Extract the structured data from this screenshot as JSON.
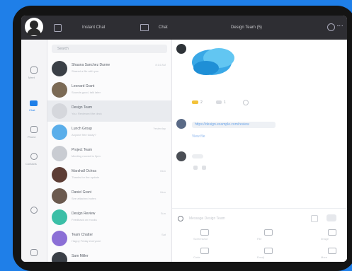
{
  "topbar": {
    "left_tab": "Instant Chat",
    "center_tab": "Chat",
    "title": "Design Team (5)"
  },
  "search": {
    "placeholder": "Search"
  },
  "contacts": [
    {
      "name": "Shauna Sanchez Dunne",
      "preview": "Shared a file with you",
      "time": "8:14 AM",
      "avatar_color": "#3a3f46"
    },
    {
      "name": "Leonard Grant",
      "preview": "Sounds good, talk later",
      "time": "",
      "avatar_color": "#7b6a55"
    },
    {
      "name": "Design Team",
      "preview": "You: Reviewed the deck",
      "time": "",
      "avatar_color": "#d5d7dc",
      "active": true
    },
    {
      "name": "Lunch Group",
      "preview": "Anyone free today?",
      "time": "Yesterday",
      "avatar_color": "#5aaeea"
    },
    {
      "name": "Project Team",
      "preview": "Meeting moved to 3pm",
      "time": "",
      "avatar_color": "#c9ccd2"
    },
    {
      "name": "Marshall Ochoa",
      "preview": "Thanks for the update",
      "time": "Mon",
      "avatar_color": "#5d3d35"
    },
    {
      "name": "Daniel Grant",
      "preview": "See attached notes",
      "time": "Mon",
      "avatar_color": "#6b5a4f"
    },
    {
      "name": "Design Review",
      "preview": "Feedback on mocks",
      "time": "Sun",
      "avatar_color": "#3bbfa7"
    },
    {
      "name": "Team Chatter",
      "preview": "Happy Friday everyone",
      "time": "Sat",
      "avatar_color": "#8b6fd6"
    },
    {
      "name": "Sam Miller",
      "preview": "",
      "time": "",
      "avatar_color": "#3a3f46"
    }
  ],
  "rail": {
    "items": [
      "Meet",
      "Chat",
      "Phone",
      "Contacts"
    ]
  },
  "chat": {
    "reaction_counts": [
      "2",
      "1"
    ],
    "link_text": "https://design.example.com/review",
    "sub_link": "View file",
    "composer_placeholder": "Message Design Team",
    "toolbar": [
      "Screenshot",
      "File",
      "Image",
      "Code",
      "Emoji",
      "More"
    ]
  }
}
